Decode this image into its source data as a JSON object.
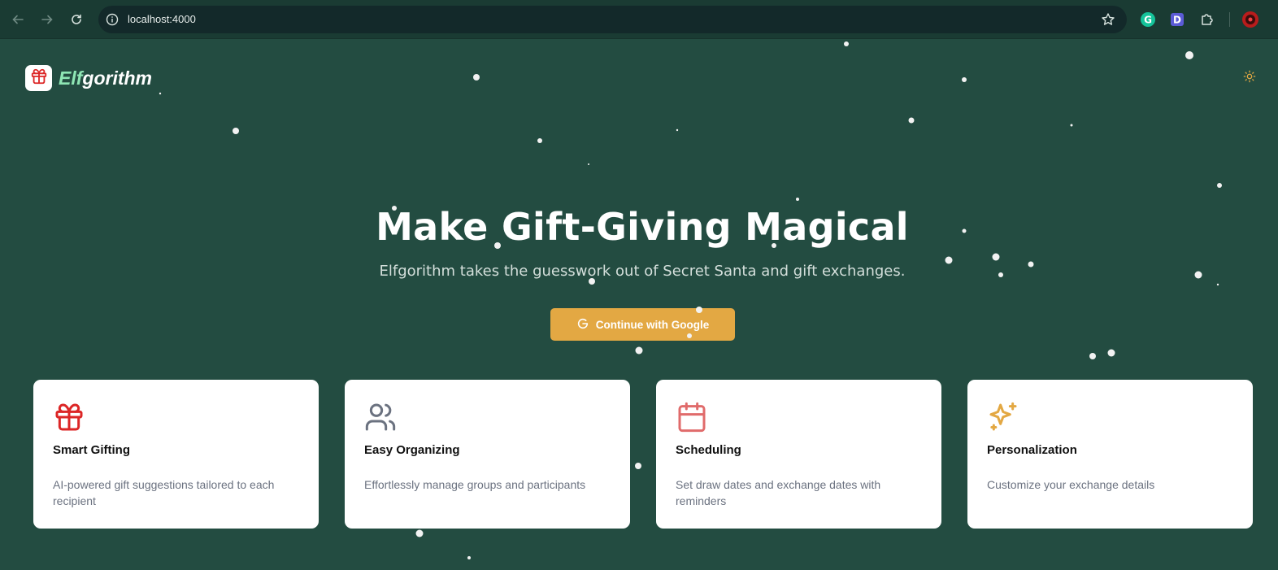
{
  "browser": {
    "url": "localhost:4000",
    "icons": [
      "back-icon",
      "forward-icon",
      "reload-icon",
      "site-info-icon",
      "bookmark-star-icon",
      "grammarly-icon",
      "d-extension-icon",
      "extensions-puzzle-icon",
      "profile-avatar-icon"
    ]
  },
  "header": {
    "brand_part1": "Elf",
    "brand_part2": "gorithm",
    "logo_icon": "gift-icon",
    "theme_icon": "sun-icon"
  },
  "hero": {
    "title": "Make Gift-Giving Magical",
    "subtitle": "Elfgorithm takes the guesswork out of Secret Santa and gift exchanges.",
    "cta_label": "Continue with Google",
    "cta_icon": "google-g-icon"
  },
  "features": [
    {
      "title": "Smart Gifting",
      "description": "AI-powered gift suggestions tailored to each recipient",
      "icon": "gift-icon",
      "color": "#dc2626"
    },
    {
      "title": "Easy Organizing",
      "description": "Effortlessly manage groups and participants",
      "icon": "users-icon",
      "color": "#6b7280"
    },
    {
      "title": "Scheduling",
      "description": "Set draw dates and exchange dates with reminders",
      "icon": "calendar-icon",
      "color": "#e06b6b"
    },
    {
      "title": "Personalization",
      "description": "Customize your exchange details",
      "icon": "sparkles-icon",
      "color": "#e3a843"
    }
  ],
  "colors": {
    "background": "#234c41",
    "accent": "#e3a843",
    "brand_highlight": "#8ee6b4"
  }
}
